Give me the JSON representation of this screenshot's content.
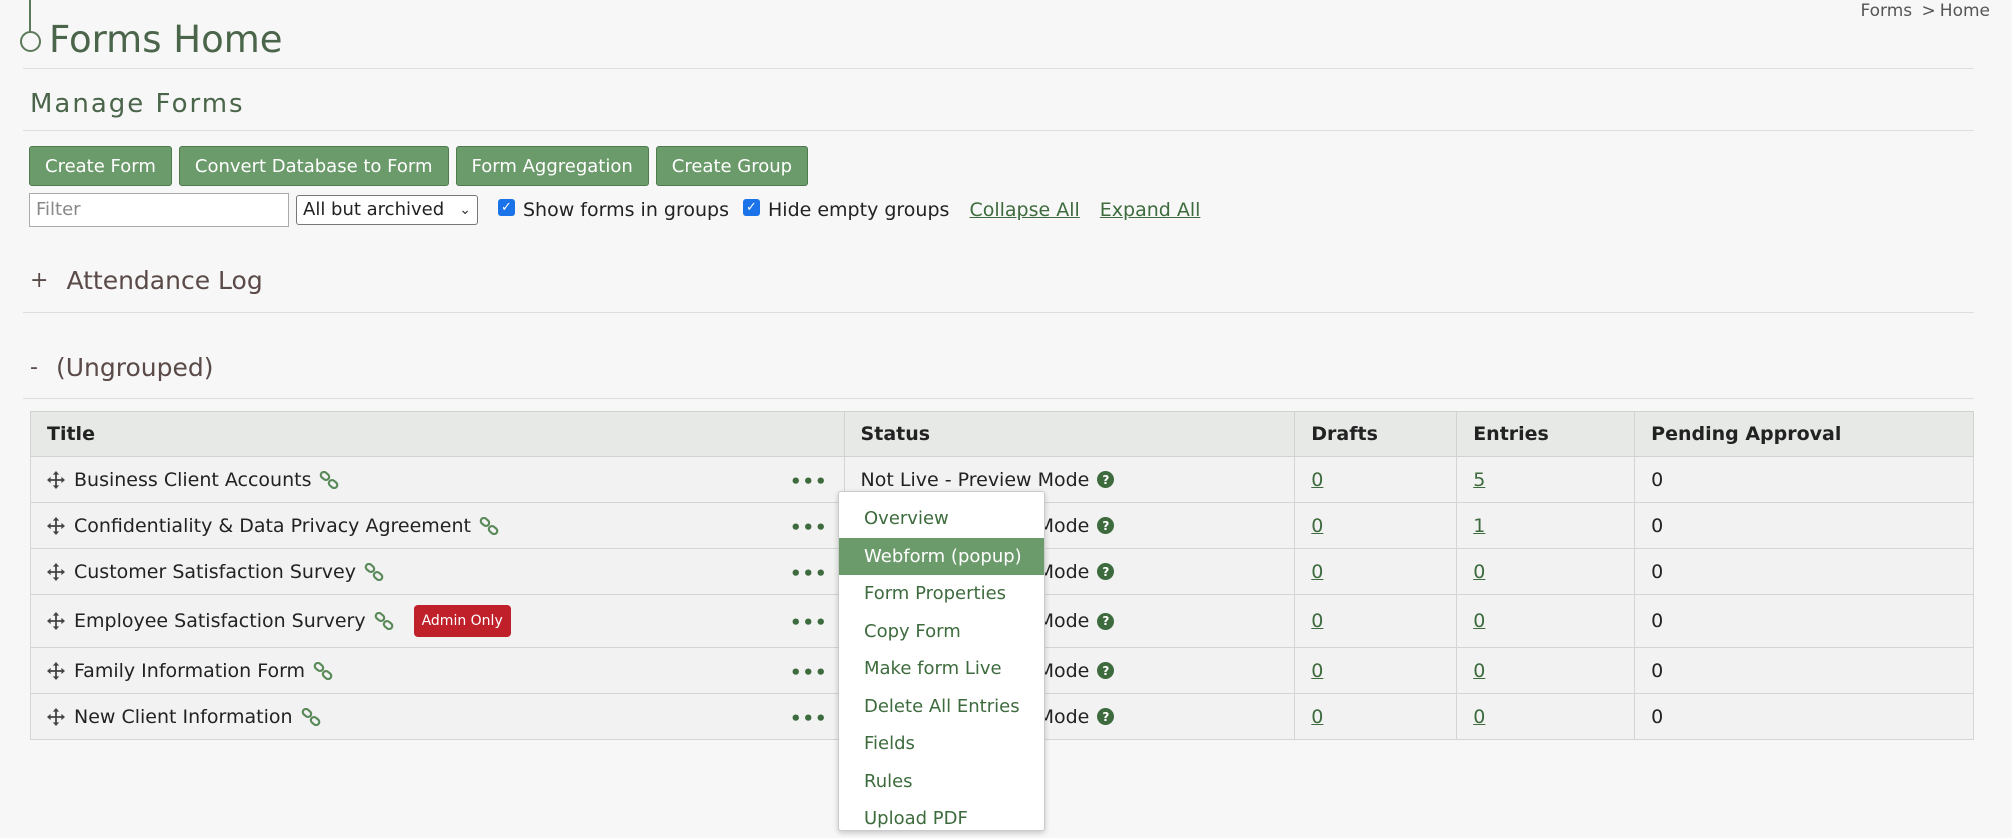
{
  "header": {
    "title": "Forms Home",
    "breadcrumb": {
      "root": "Forms",
      "separator": ">",
      "current": "Home"
    }
  },
  "section": {
    "title": "Manage Forms"
  },
  "toolbar": {
    "buttons": [
      "Create Form",
      "Convert Database to Form",
      "Form Aggregation",
      "Create Group"
    ]
  },
  "filters": {
    "filter_placeholder": "Filter",
    "filter_value": "",
    "view_select": "All but archived",
    "show_in_groups": {
      "label": "Show forms in groups",
      "checked": true
    },
    "hide_empty": {
      "label": "Hide empty groups",
      "checked": true
    },
    "collapse_all": "Collapse All",
    "expand_all": "Expand All"
  },
  "groups": [
    {
      "sign": "+",
      "name": "Attendance Log",
      "expanded": false
    },
    {
      "sign": "-",
      "name": "(Ungrouped)",
      "expanded": true
    }
  ],
  "table": {
    "columns": [
      "Title",
      "Status",
      "Drafts",
      "Entries",
      "Pending Approval"
    ],
    "rows": [
      {
        "title": "Business Client Accounts",
        "badge": "",
        "status": "Not Live - Preview Mode",
        "drafts": "0",
        "entries": "5",
        "pending": "0"
      },
      {
        "title": "Confidentiality & Data Privacy Agreement",
        "badge": "",
        "status": "Not Live - Preview Mode",
        "drafts": "0",
        "entries": "1",
        "pending": "0"
      },
      {
        "title": "Customer Satisfaction Survey",
        "badge": "",
        "status": "Not Live - Preview Mode",
        "drafts": "0",
        "entries": "0",
        "pending": "0"
      },
      {
        "title": "Employee Satisfaction Survery",
        "badge": "Admin Only",
        "status": "Not Live - Preview Mode",
        "drafts": "0",
        "entries": "0",
        "pending": "0"
      },
      {
        "title": "Family Information Form",
        "badge": "",
        "status": "Not Live - Preview Mode",
        "drafts": "0",
        "entries": "0",
        "pending": "0"
      },
      {
        "title": "New Client Information",
        "badge": "",
        "status": "Not Live - Preview Mode",
        "drafts": "0",
        "entries": "0",
        "pending": "0"
      }
    ]
  },
  "context_menu": {
    "items": [
      "Overview",
      "Webform (popup)",
      "Form Properties",
      "Copy Form",
      "Make form Live",
      "Delete All Entries",
      "Fields",
      "Rules",
      "Upload PDF"
    ],
    "highlighted": "Webform (popup)"
  },
  "icons": {
    "row_handle": "move-icon",
    "link": "chain-link-icon",
    "actions": "more-dots-icon",
    "help": "question-circle-icon"
  },
  "colors": {
    "accent": "#6b9a6b",
    "link": "#3d6b3d",
    "badge": "#c0202a",
    "title": "#4a654a"
  }
}
